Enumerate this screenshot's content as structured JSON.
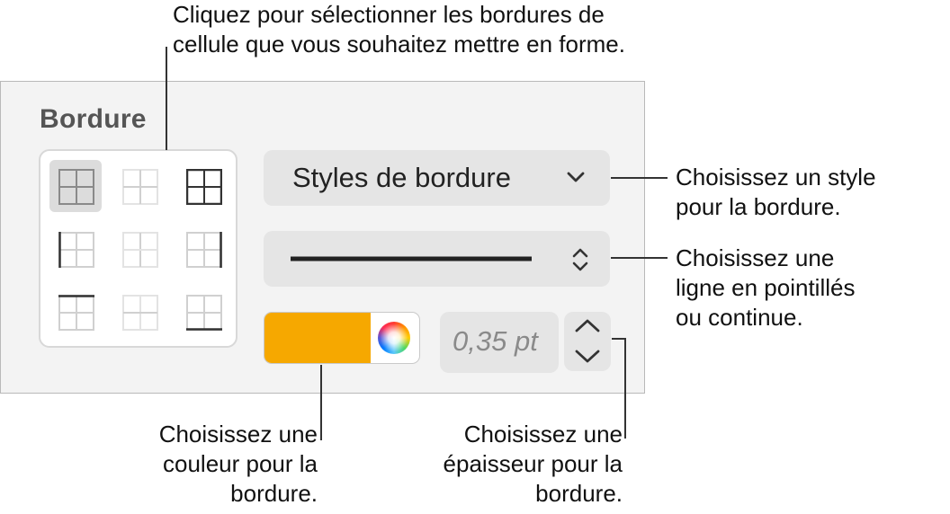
{
  "callouts": {
    "top": [
      "Cliquez pour sélectionner les bordures de",
      "cellule que vous souhaitez mettre en forme."
    ],
    "style": [
      "Choisissez un style",
      "pour la bordure."
    ],
    "line": [
      "Choisissez une",
      "ligne en pointillés",
      "ou continue."
    ],
    "color": [
      "Choisissez une",
      "couleur pour la",
      "bordure."
    ],
    "thickness": [
      "Choisissez une",
      "épaisseur pour la",
      "bordure."
    ]
  },
  "panel": {
    "heading": "Bordure",
    "styles_button_label": "Styles de bordure",
    "line_style": "solid",
    "color": "#f6a800",
    "thickness": "0,35 pt"
  },
  "border_options": [
    {
      "name": "all-borders",
      "selected": true
    },
    {
      "name": "inside-borders",
      "selected": false
    },
    {
      "name": "outside-borders",
      "selected": false
    },
    {
      "name": "left-border",
      "selected": false
    },
    {
      "name": "inside-vertical-border",
      "selected": false
    },
    {
      "name": "right-border",
      "selected": false
    },
    {
      "name": "top-border",
      "selected": false
    },
    {
      "name": "inside-horizontal-border",
      "selected": false
    },
    {
      "name": "bottom-border",
      "selected": false
    }
  ]
}
